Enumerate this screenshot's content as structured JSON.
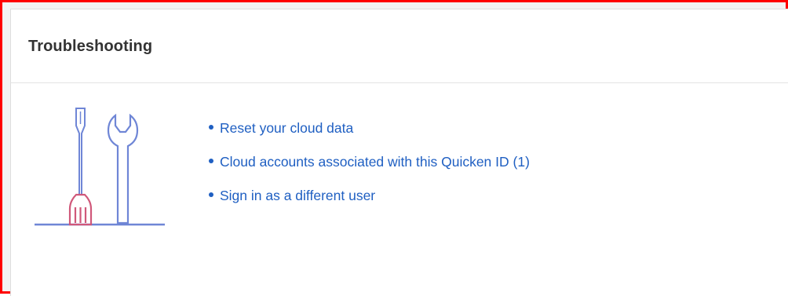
{
  "panel": {
    "title": "Troubleshooting"
  },
  "illustration": {
    "icon": "tools-icon",
    "colors": {
      "outline": "#6f86d6",
      "handle": "#d0587a",
      "ground": "#6f86d6"
    }
  },
  "links": [
    {
      "label": "Reset your cloud data"
    },
    {
      "label": "Cloud accounts associated with this Quicken ID (1)"
    },
    {
      "label": "Sign in as a different user"
    }
  ],
  "theme": {
    "frame_border": "#ff0000",
    "link_color": "#1f5fc2",
    "title_color": "#333333"
  }
}
